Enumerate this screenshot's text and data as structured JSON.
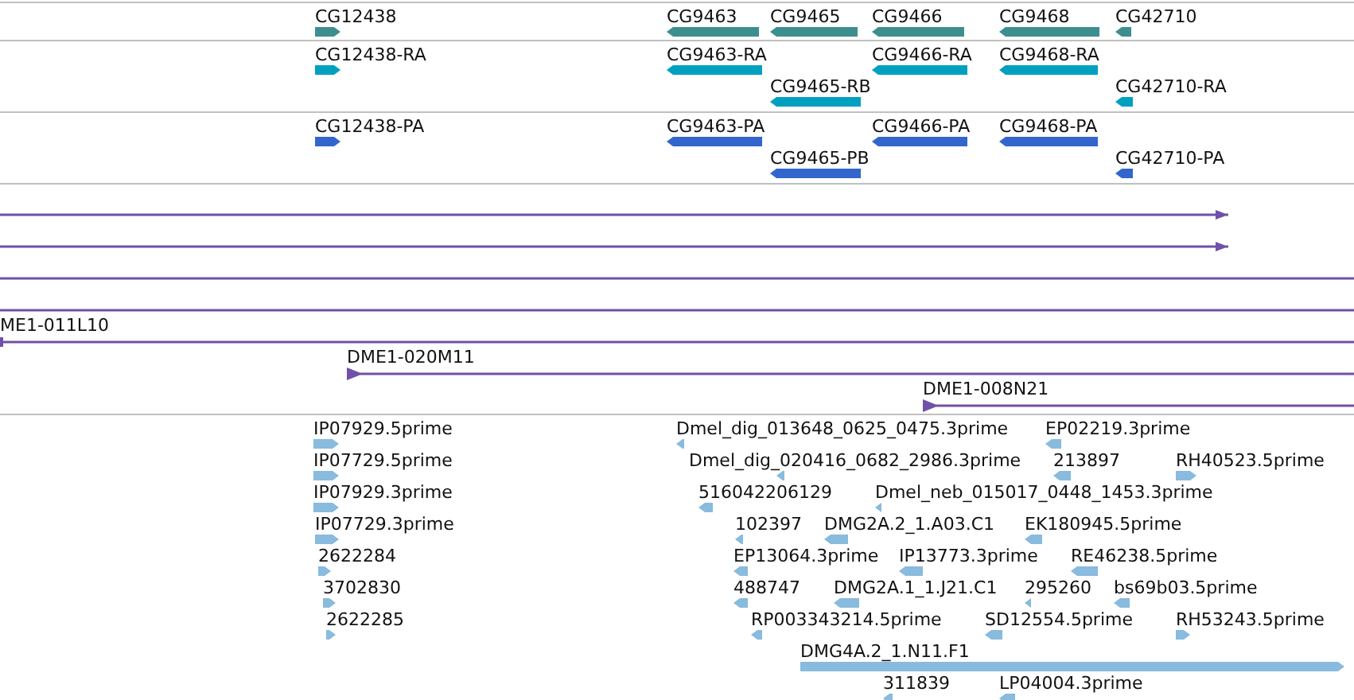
{
  "tracks": [
    {
      "kind": "genes",
      "features": [
        {
          "label": "CG12438",
          "reverse": false
        },
        {
          "label": "CG9463",
          "reverse": true
        },
        {
          "label": "CG9465",
          "reverse": true
        },
        {
          "label": "CG9466",
          "reverse": true
        },
        {
          "label": "CG9468",
          "reverse": true
        },
        {
          "label": "CG42710",
          "reverse": true
        }
      ]
    },
    {
      "kind": "transcripts",
      "features": [
        {
          "label": "CG12438-RA",
          "reverse": false
        },
        {
          "label": "CG9463-RA",
          "reverse": true
        },
        {
          "label": "CG9466-RA",
          "reverse": true
        },
        {
          "label": "CG9468-RA",
          "reverse": true
        },
        {
          "label": "CG9465-RB",
          "reverse": true
        },
        {
          "label": "CG42710-RA",
          "reverse": true
        }
      ]
    },
    {
      "kind": "proteins",
      "features": [
        {
          "label": "CG12438-PA",
          "reverse": false
        },
        {
          "label": "CG9463-PA",
          "reverse": true
        },
        {
          "label": "CG9466-PA",
          "reverse": true
        },
        {
          "label": "CG9468-PA",
          "reverse": true
        },
        {
          "label": "CG9465-PB",
          "reverse": true
        },
        {
          "label": "CG42710-PA",
          "reverse": true
        }
      ]
    },
    {
      "kind": "clones",
      "features": [
        {
          "arrowhead": true
        },
        {
          "arrowhead": true
        },
        {
          "arrowhead": false
        },
        {
          "arrowhead": false
        },
        {
          "label": "ME1-011L10",
          "arrowhead": false
        },
        {
          "label": "DME1-020M11",
          "arrowhead": true
        },
        {
          "label": "DME1-008N21",
          "arrowhead": true
        }
      ]
    },
    {
      "kind": "ests",
      "features": [
        {
          "label": "IP07929.5prime",
          "reverse": false
        },
        {
          "label": "Dmel_dig_013648_0625_0475.3prime",
          "reverse": true
        },
        {
          "label": "EP02219.3prime",
          "reverse": true
        },
        {
          "label": "IP07729.5prime",
          "reverse": false
        },
        {
          "label": "Dmel_dig_020416_0682_2986.3prime",
          "reverse": true
        },
        {
          "label": "213897",
          "reverse": true
        },
        {
          "label": "RH40523.5prime",
          "reverse": false
        },
        {
          "label": "IP07929.3prime",
          "reverse": false
        },
        {
          "label": "516042206129",
          "reverse": true
        },
        {
          "label": "Dmel_neb_015017_0448_1453.3prime",
          "reverse": true
        },
        {
          "label": "IP07729.3prime",
          "reverse": false
        },
        {
          "label": "102397",
          "reverse": true
        },
        {
          "label": "DMG2A.2_1.A03.C1",
          "reverse": true
        },
        {
          "label": "EK180945.5prime",
          "reverse": true
        },
        {
          "label": "2622284",
          "reverse": false
        },
        {
          "label": "EP13064.3prime",
          "reverse": true
        },
        {
          "label": "IP13773.3prime",
          "reverse": true
        },
        {
          "label": "RE46238.5prime",
          "reverse": true
        },
        {
          "label": "3702830",
          "reverse": false
        },
        {
          "label": "488747",
          "reverse": true
        },
        {
          "label": "DMG2A.1_1.J21.C1",
          "reverse": true
        },
        {
          "label": "295260",
          "reverse": true
        },
        {
          "label": "bs69b03.5prime",
          "reverse": true
        },
        {
          "label": "2622285",
          "reverse": false
        },
        {
          "label": "RP003343214.5prime",
          "reverse": true
        },
        {
          "label": "SD12554.5prime",
          "reverse": true
        },
        {
          "label": "RH53243.5prime",
          "reverse": false
        },
        {
          "label": "DMG4A.2_1.N11.F1",
          "reverse": false
        },
        {
          "label": "311839",
          "reverse": true
        },
        {
          "label": "LP04004.3prime",
          "reverse": true
        }
      ]
    }
  ]
}
